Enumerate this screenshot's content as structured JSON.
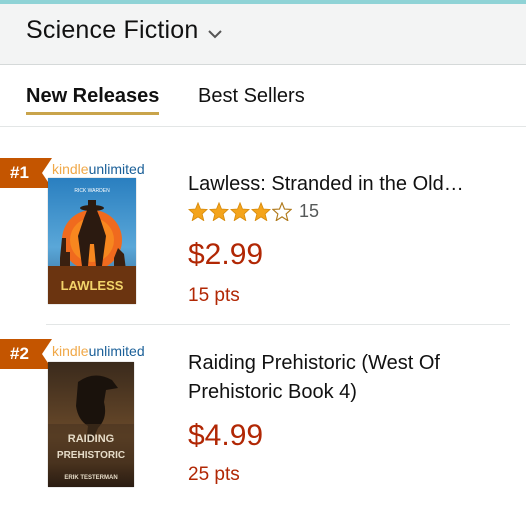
{
  "header": {
    "category_label": "Science Fiction"
  },
  "tabs": [
    {
      "label": "New Releases",
      "active": true
    },
    {
      "label": "Best Sellers",
      "active": false
    }
  ],
  "badge": {
    "kindle": "kindle",
    "unlimited": "unlimited"
  },
  "items": [
    {
      "rank": "#1",
      "title": "Lawless: Stranded in the Old…",
      "rating": 4,
      "review_count": "15",
      "price": "$2.99",
      "points": "15 pts",
      "cover_title": "LAWLESS",
      "cover_author": "RICK WARDEN"
    },
    {
      "rank": "#2",
      "title": "Raiding Prehistoric (West Of Prehistoric Book 4)",
      "price": "$4.99",
      "points": "25 pts",
      "cover_title_line1": "RAIDING",
      "cover_title_line2": "PREHISTORIC",
      "cover_author": "ERIK TESTERMAN"
    }
  ],
  "colors": {
    "price": "#b12704",
    "rank_badge": "#c45500",
    "tab_underline": "#c9a44b",
    "star": "#f4a41c"
  }
}
